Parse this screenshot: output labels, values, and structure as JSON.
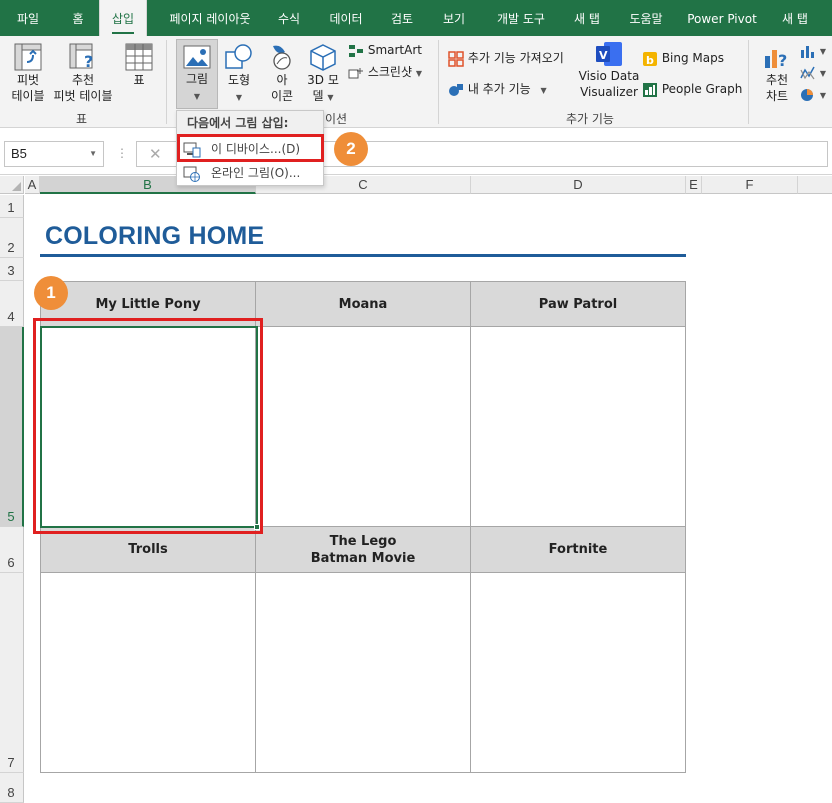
{
  "tabs": [
    {
      "label": "파일",
      "active": false
    },
    {
      "label": "홈",
      "active": false
    },
    {
      "label": "삽입",
      "active": true
    },
    {
      "label": "페이지 레이아웃",
      "active": false
    },
    {
      "label": "수식",
      "active": false
    },
    {
      "label": "데이터",
      "active": false
    },
    {
      "label": "검토",
      "active": false
    },
    {
      "label": "보기",
      "active": false
    },
    {
      "label": "개발 도구",
      "active": false
    },
    {
      "label": "새 탭",
      "active": false
    },
    {
      "label": "도움말",
      "active": false
    },
    {
      "label": "Power Pivot",
      "active": false
    },
    {
      "label": "새 탭",
      "active": false
    }
  ],
  "ribbon": {
    "pivot_table": [
      "피벗",
      "테이블"
    ],
    "recommended_pivot": [
      "추천",
      "피벗 테이블"
    ],
    "table": "표",
    "group_table": "표",
    "picture": "그림",
    "shapes": "도형",
    "icons": [
      "아",
      "이콘"
    ],
    "model3d": [
      "3D 모",
      "델"
    ],
    "smartart": "SmartArt",
    "screenshot": "스크린샷",
    "group_illustrations_tail": "이션",
    "get_addins": "추가 기능 가져오기",
    "my_addins": "내 추가 기능",
    "visio": [
      "Visio Data",
      "Visualizer"
    ],
    "bing_maps": "Bing Maps",
    "people_graph": "People Graph",
    "group_addins": "추가 기능",
    "recommended_charts": [
      "추천",
      "차트"
    ]
  },
  "formula_bar": {
    "name_box": "B5",
    "cancel_symbol": "✕"
  },
  "insert_picture_menu": {
    "header": "다음에서 그림 삽입:",
    "items": [
      "이 디바이스...(D)",
      "온라인 그림(O)..."
    ]
  },
  "callouts": [
    "1",
    "2"
  ],
  "grid": {
    "columns": [
      "A",
      "B",
      "C",
      "D",
      "E",
      "F"
    ],
    "rows": [
      "1",
      "2",
      "3",
      "4",
      "5",
      "6",
      "7",
      "8"
    ],
    "selected_cell": "B5"
  },
  "sheet": {
    "title": "COLORING HOME",
    "row1_headers": [
      "My Little Pony",
      "Moana",
      "Paw Patrol"
    ],
    "row2_headers": [
      "Trolls",
      "The Lego\nBatman Movie",
      "Fortnite"
    ]
  },
  "colors": {
    "excel_green": "#217346",
    "title_blue": "#1f5c99",
    "highlight_red": "#e02020",
    "callout_orange": "#ef8e39"
  }
}
